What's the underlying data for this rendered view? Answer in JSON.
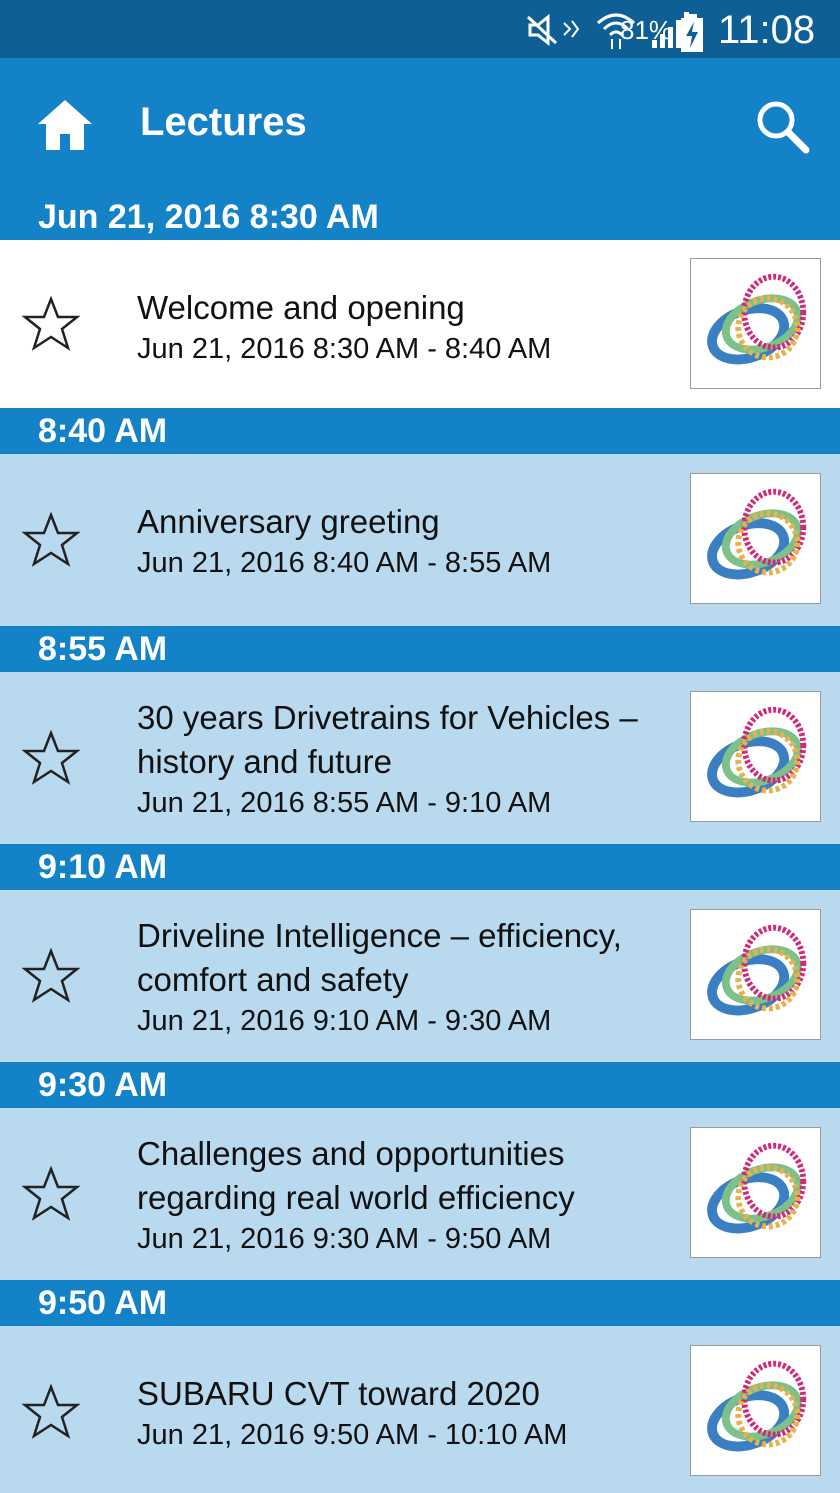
{
  "status": {
    "battery": "81%",
    "time": "11:08"
  },
  "appbar": {
    "title": "Lectures"
  },
  "sections": [
    {
      "header": "Jun 21, 2016 8:30 AM",
      "title": "Welcome and opening",
      "time": "Jun 21, 2016 8:30 AM - 8:40 AM"
    },
    {
      "header": "8:40 AM",
      "title": "Anniversary greeting",
      "time": "Jun 21, 2016 8:40 AM - 8:55 AM"
    },
    {
      "header": "8:55 AM",
      "title": "30 years Drivetrains for Vehicles – history and future",
      "time": "Jun 21, 2016 8:55 AM - 9:10 AM"
    },
    {
      "header": "9:10 AM",
      "title": "Driveline Intelligence – efficiency, comfort and safety",
      "time": "Jun 21, 2016 9:10 AM - 9:30 AM"
    },
    {
      "header": "9:30 AM",
      "title": "Challenges and opportunities regarding real world efficiency",
      "time": "Jun 21, 2016 9:30 AM - 9:50 AM"
    },
    {
      "header": "9:50 AM",
      "title": "SUBARU CVT toward 2020",
      "time": "Jun 21, 2016 9:50 AM - 10:10 AM"
    }
  ],
  "icons": {
    "home": "home-icon",
    "search": "search-icon",
    "favorite": "star-outline-icon",
    "thumb": "event-logo-rings"
  },
  "colors": {
    "appbar": "#1382c6",
    "statusbar": "#0d5f95",
    "rowbg": "#b9daee"
  }
}
